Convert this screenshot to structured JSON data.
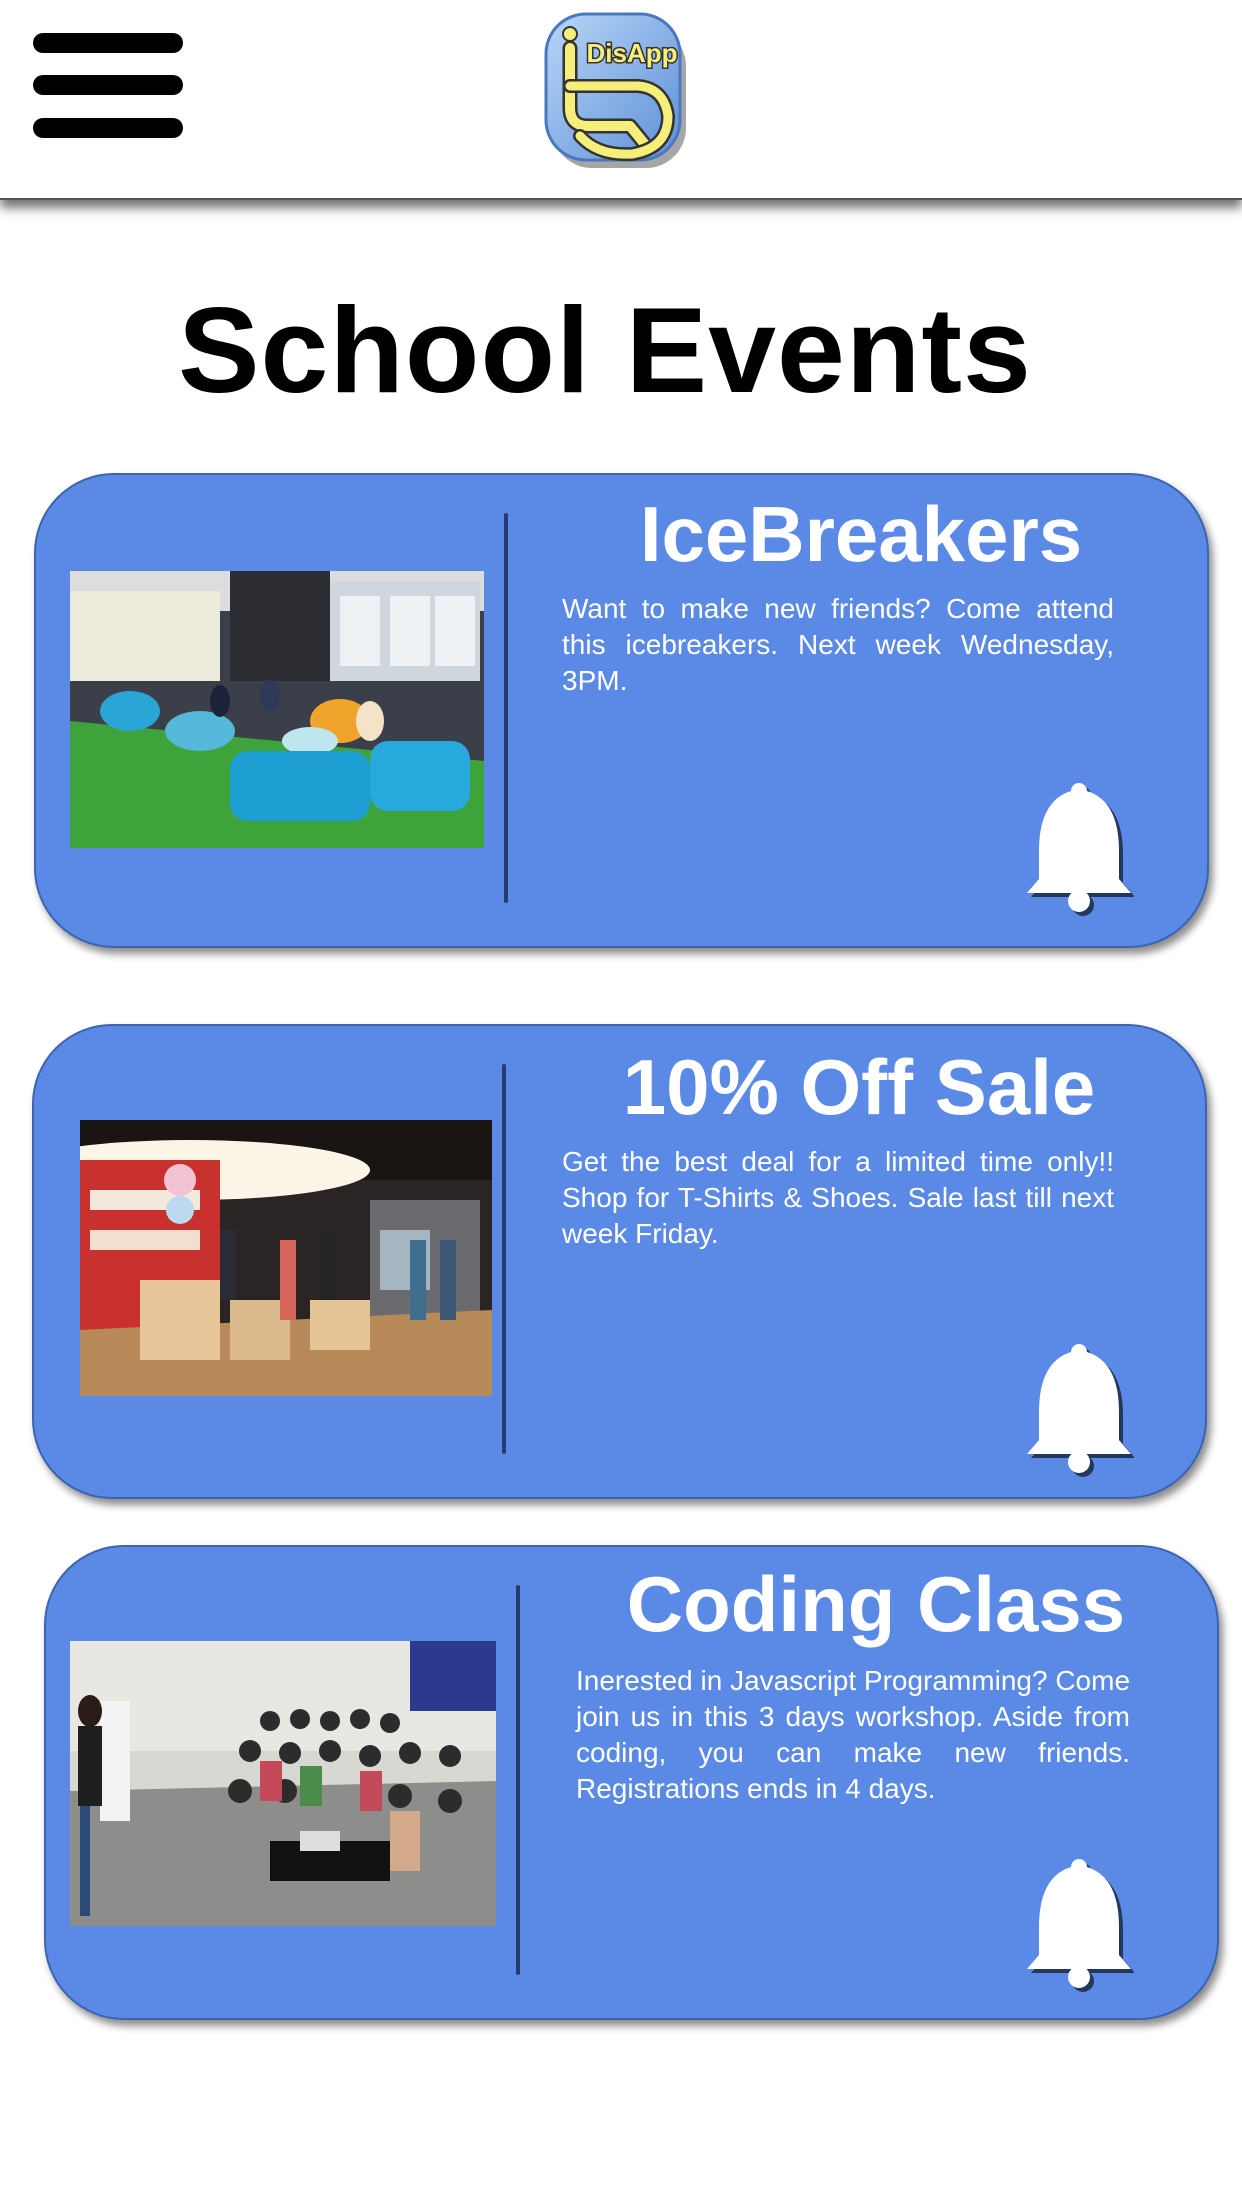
{
  "header": {
    "logo_text": "DisApp"
  },
  "page": {
    "title": "School Events"
  },
  "events": [
    {
      "title": "IceBreakers",
      "description": "Want to make new friends? Come attend this icebreakers. Next week Wednesday, 3PM.",
      "icon": "bell-icon"
    },
    {
      "title": "10% Off Sale",
      "description": "Get the best deal for a limited time only!! Shop for T-Shirts & Shoes. Sale last till next week Friday.",
      "icon": "bell-icon"
    },
    {
      "title": "Coding Class",
      "description": "Inerested in Javascript Programming? Come join us in this 3 days workshop. Aside from coding, you can make new friends. Registrations ends in 4 days.",
      "icon": "bell-icon"
    }
  ],
  "colors": {
    "card_bg": "#5b8ae6",
    "logo_blue": "#8fb8f0",
    "logo_yellow": "#f5ef7a"
  }
}
